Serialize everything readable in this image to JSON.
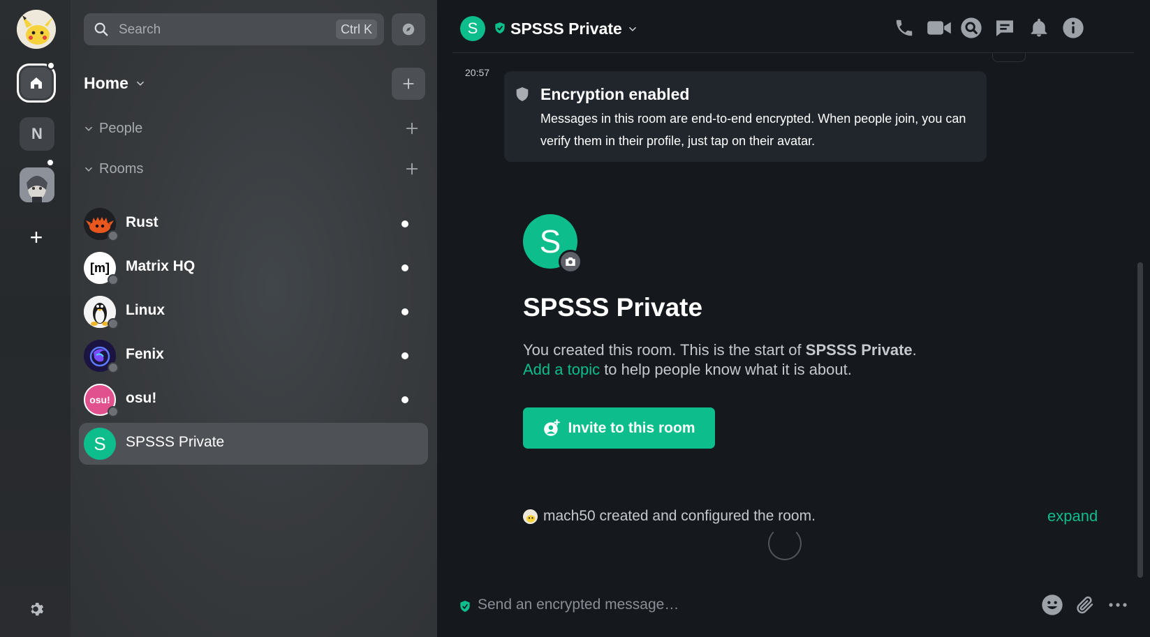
{
  "spaces": {
    "new_space_label": "+",
    "n_space_label": "N"
  },
  "sidebar": {
    "search_placeholder": "Search",
    "search_shortcut": "Ctrl K",
    "home_label": "Home",
    "sections": [
      {
        "label": "People"
      },
      {
        "label": "Rooms"
      }
    ],
    "rooms": [
      {
        "name": "Rust",
        "unread": true
      },
      {
        "name": "Matrix HQ",
        "unread": true
      },
      {
        "name": "Linux",
        "unread": true
      },
      {
        "name": "Fenix",
        "unread": true
      },
      {
        "name": "osu!",
        "unread": true
      },
      {
        "name": "SPSSS Private",
        "unread": false,
        "selected": true
      }
    ],
    "avatar_letters": {
      "matrix": "[m]",
      "osu": "osu!",
      "spsss": "S"
    }
  },
  "header": {
    "avatar_letter": "S",
    "room_name": "SPSSS Private"
  },
  "timeline": {
    "timestamp": "20:57",
    "encryption_title": "Encryption enabled",
    "encryption_body": "Messages in this room are end-to-end encrypted. When people join, you can verify them in their profile, just tap on their avatar.",
    "room_avatar_letter": "S",
    "room_heading": "SPSSS Private",
    "intro_prefix": "You created this room. This is the start of ",
    "intro_room": "SPSSS Private",
    "intro_period": ".",
    "topic_link": "Add a topic",
    "intro_suffix": " to help people know what it is about.",
    "invite_label": "Invite to this room",
    "created_text": "mach50 created and configured the room.",
    "expand_label": "expand"
  },
  "composer": {
    "placeholder": "Send an encrypted message…"
  },
  "colors": {
    "accent": "#0dbd8b",
    "background": "#15191e",
    "card": "#21262c"
  }
}
